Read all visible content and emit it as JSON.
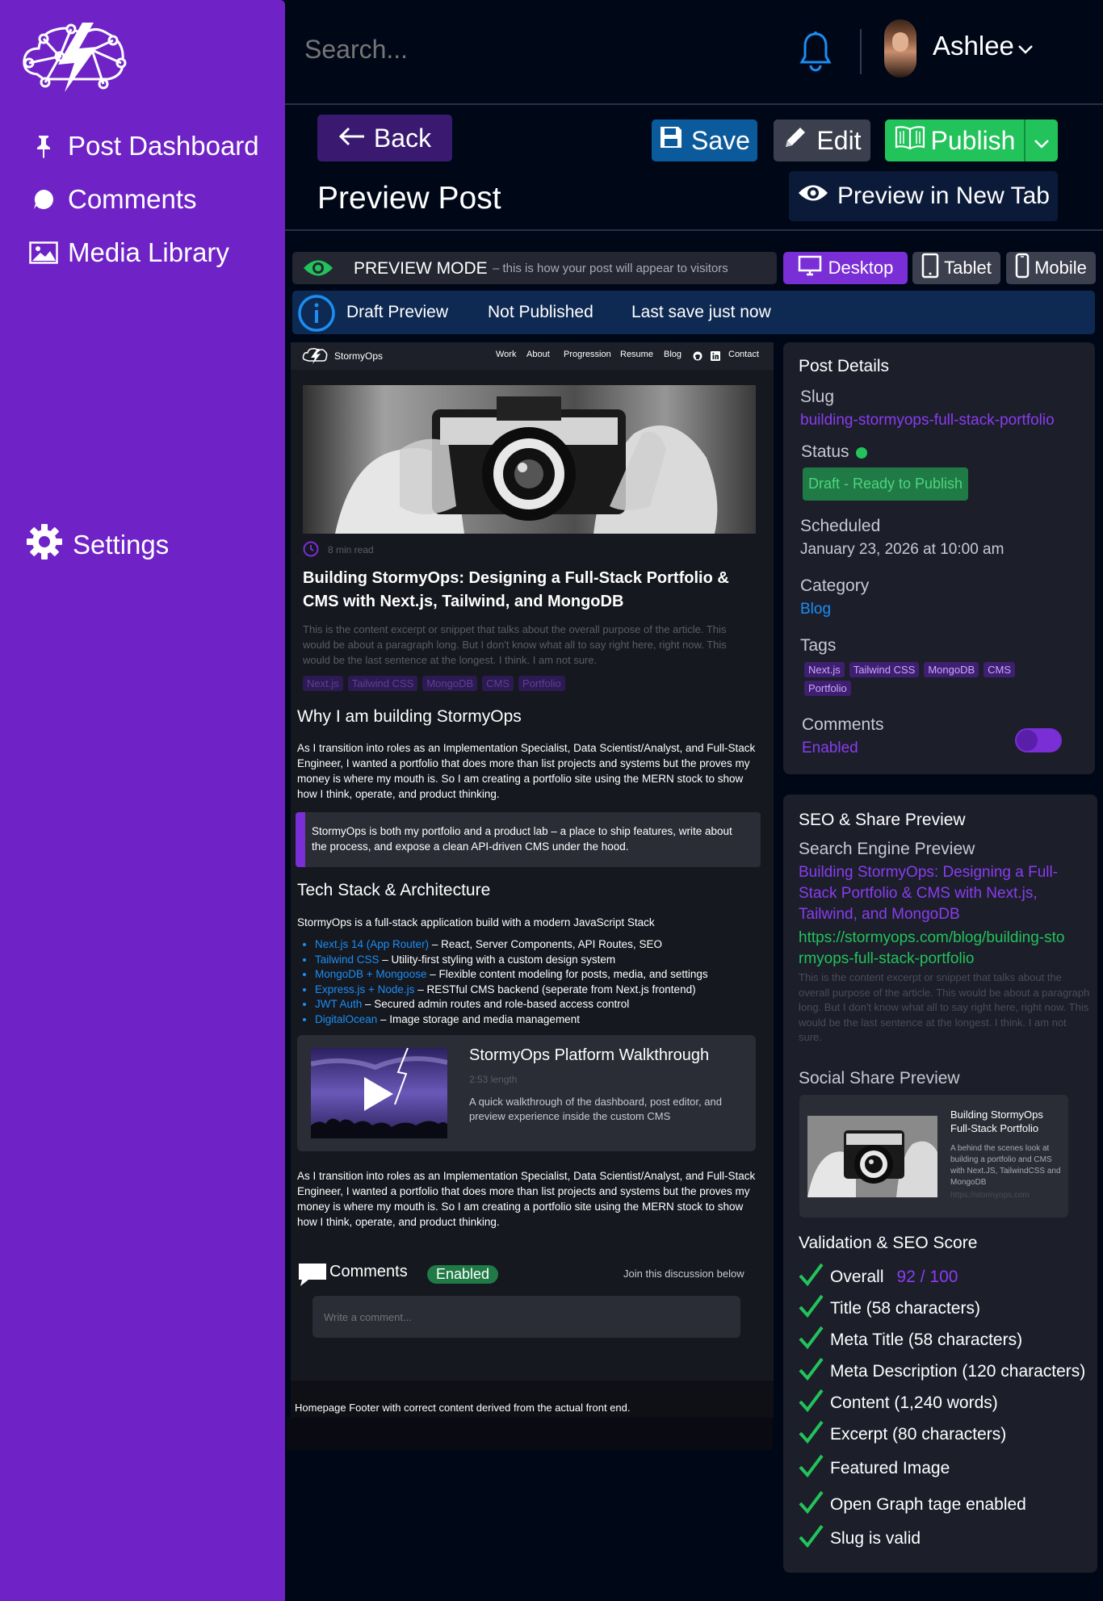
{
  "sidebar": {
    "items": [
      {
        "label": "Post Dashboard",
        "icon": "pin-icon"
      },
      {
        "label": "Comments",
        "icon": "chat-bubble-icon"
      },
      {
        "label": "Media Library",
        "icon": "image-icon"
      }
    ],
    "settings_label": "Settings"
  },
  "topbar": {
    "search_placeholder": "Search...",
    "user_name": "Ashlee"
  },
  "header": {
    "back_label": "Back",
    "save_label": "Save",
    "edit_label": "Edit",
    "publish_label": "Publish",
    "preview_new_tab_label": "Preview in New Tab",
    "page_title": "Preview Post"
  },
  "preview_bar": {
    "mode_label": "PREVIEW MODE",
    "mode_hint": "– this is how your post will appear to visitors",
    "devices": [
      "Desktop",
      "Tablet",
      "Mobile"
    ],
    "active_device": "Desktop"
  },
  "status_bar": {
    "draft_label": "Draft Preview",
    "published_label": "Not Published",
    "last_save": "Last save just now"
  },
  "site_preview": {
    "brand": "StormyOps",
    "nav": [
      "Work",
      "About",
      "Progression",
      "Resume",
      "Blog",
      "Contact"
    ],
    "read_time": "8 min read",
    "title": "Building StormyOps: Designing a Full-Stack Portfolio & CMS with Next.js, Tailwind, and MongoDB",
    "excerpt": "This is the content excerpt or snippet that talks about the overall purpose of the article. This would be about a paragraph long. But I don't know what all to say right here, right now. This would be the last sentence at the longest. I think. I am not sure.",
    "tags": [
      "Next.js",
      "Tailwind CSS",
      "MongoDB",
      "CMS",
      "Portfolio"
    ],
    "h_why": "Why I am building StormyOps",
    "p1": "As I transition into roles as an Implementation Specialist, Data Scientist/Analyst, and Full-Stack Engineer, I wanted a portfolio that does more than list projects and systems but the proves my money is where my mouth is. So I am creating a portfolio site using the MERN stock to show how I think, operate, and product thinking.",
    "quote": "StormyOps is both my portfolio and a product lab – a place to ship features, write about the process, and expose a clean API-driven CMS under the hood.",
    "h_tech": "Tech Stack & Architecture",
    "tech_intro": "StormyOps is a full-stack application build with a modern JavaScript Stack",
    "tech_list": [
      {
        "name": "Next.js 14 (App Router)",
        "desc": " – React, Server Components, API Routes, SEO"
      },
      {
        "name": "Tailwind CSS",
        "desc": " – Utility-first styling with a custom design system"
      },
      {
        "name": "MongoDB + Mongoose",
        "desc": " – Flexible content modeling for posts, media, and settings"
      },
      {
        "name": "Express.js + Node.js",
        "desc": " – RESTful CMS backend (seperate from Next.js frontend)"
      },
      {
        "name": "JWT Auth",
        "desc": " – Secured admin routes and role-based access control"
      },
      {
        "name": "DigitalOcean",
        "desc": " – Image storage and media management"
      }
    ],
    "video": {
      "title": "StormyOps Platform Walkthrough",
      "length": "2:53 length",
      "desc": "A quick walkthrough of the dashboard, post editor, and preview experience inside the custom CMS"
    },
    "p2": "As I transition into roles as an Implementation Specialist, Data Scientist/Analyst, and Full-Stack Engineer, I wanted a portfolio that does more than list projects and systems but the proves my money is where my mouth is. So I am creating a portfolio site using the MERN stock to show how I think, operate, and product thinking.",
    "comments_label": "Comments",
    "comments_badge": "Enabled",
    "comments_hint": "Join this discussion below",
    "comment_placeholder": "Write a comment...",
    "footer": "Homepage Footer with correct content derived from the actual front end."
  },
  "post_details": {
    "title": "Post Details",
    "slug_label": "Slug",
    "slug": "building-stormyops-full-stack-portfolio",
    "status_label": "Status",
    "status_value": "Draft - Ready to Publish",
    "scheduled_label": "Scheduled",
    "scheduled_value": "January 23, 2026 at 10:00 am",
    "category_label": "Category",
    "category_value": "Blog",
    "tags_label": "Tags",
    "tags": [
      "Next.js",
      "Tailwind CSS",
      "MongoDB",
      "CMS",
      "Portfolio"
    ],
    "comments_label": "Comments",
    "comments_value": "Enabled"
  },
  "seo": {
    "title": "SEO & Share Preview",
    "search_label": "Search Engine Preview",
    "search_title": "Building StormyOps: Designing a Full-Stack Portfolio & CMS with Next.js, Tailwind, and MongoDB",
    "search_url": "https://stormyops.com/blog/building-stormyops-full-stack-portfolio",
    "search_desc": "This is the content excerpt or snippet that talks about the overall purpose of the article. This would be about a paragraph long. But I don't know what all to say right here, right now. This would be the last sentence at the longest. I think. I am not sure.",
    "social_label": "Social Share Preview",
    "social_title": "Building StormyOps Full-Stack Portfolio",
    "social_desc": "A behind the scenes look at building a portfolio and CMS with Next.JS, TailwindCSS and MongoDB",
    "social_url": "https://stormyops.com"
  },
  "validation": {
    "title": "Validation & SEO Score",
    "overall_label": "Overall",
    "score": "92 / 100",
    "items": [
      "Title (58 characters)",
      "Meta Title (58 characters)",
      "Meta Description (120 characters)",
      "Content (1,240 words)",
      "Excerpt (80 characters)",
      "Featured Image",
      "Open Graph tage enabled",
      "Slug is valid"
    ]
  },
  "colors": {
    "sidebar": "#6f23c6",
    "accent_purple": "#8a3cf0",
    "save_blue": "#0b5a9c",
    "publish_green": "#22c35a",
    "status_green": "#1f7a45",
    "check_green": "#22c35a"
  }
}
